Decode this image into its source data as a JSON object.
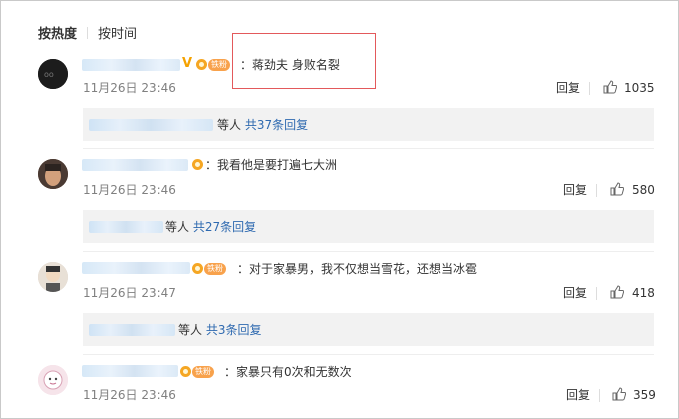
{
  "sort": {
    "hot_label": "按热度",
    "time_label": "按时间"
  },
  "comments": [
    {
      "text": "：蒋劲夫 身败名裂",
      "time": "11月26日 23:46",
      "reply_label": "回复",
      "likes": "1035",
      "replies_prefix": "等人",
      "replies_link": "共37条回复",
      "fan_badge": "铁粉",
      "has_v_badge": true
    },
    {
      "text": "：我看他是要打遍七大洲",
      "time": "11月26日 23:46",
      "reply_label": "回复",
      "likes": "580",
      "replies_prefix": "等人",
      "replies_link": "共27条回复"
    },
    {
      "text": "：对于家暴男，我不仅想当雪花，还想当冰雹",
      "time": "11月26日 23:47",
      "reply_label": "回复",
      "likes": "418",
      "replies_prefix": "等人",
      "replies_link": "共3条回复",
      "fan_badge": "铁粉"
    },
    {
      "text": "：家暴只有0次和无数次",
      "time": "11月26日 23:46",
      "reply_label": "回复",
      "likes": "359",
      "fan_badge": "铁粉"
    }
  ],
  "colors": {
    "link": "#2f6ab0",
    "highlight_border": "#e3595b",
    "badge_orange": "#f8a24c",
    "subbox_bg": "#f2f2f2"
  }
}
